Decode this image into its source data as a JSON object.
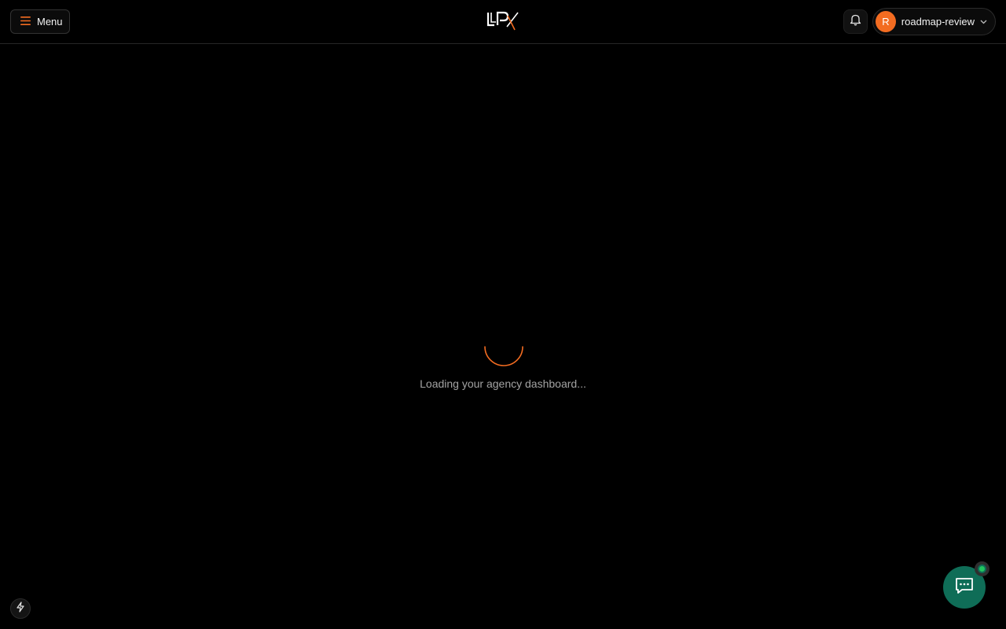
{
  "header": {
    "menu_label": "Menu",
    "logo_icon": "lpx-logo",
    "notifications_icon": "bell-icon",
    "user": {
      "avatar_initial": "R",
      "name": "roadmap-review",
      "dropdown_icon": "chevron-down-icon"
    }
  },
  "main": {
    "loading_text": "Loading your agency dashboard..."
  },
  "footer": {
    "quick_action_icon": "bolt-icon",
    "chat_icon": "chat-icon"
  },
  "colors": {
    "background": "#000000",
    "accent": "#f36c21",
    "chat_button": "#0f6d57",
    "online_status": "#22c55e",
    "muted_text": "#a3a3a3"
  }
}
